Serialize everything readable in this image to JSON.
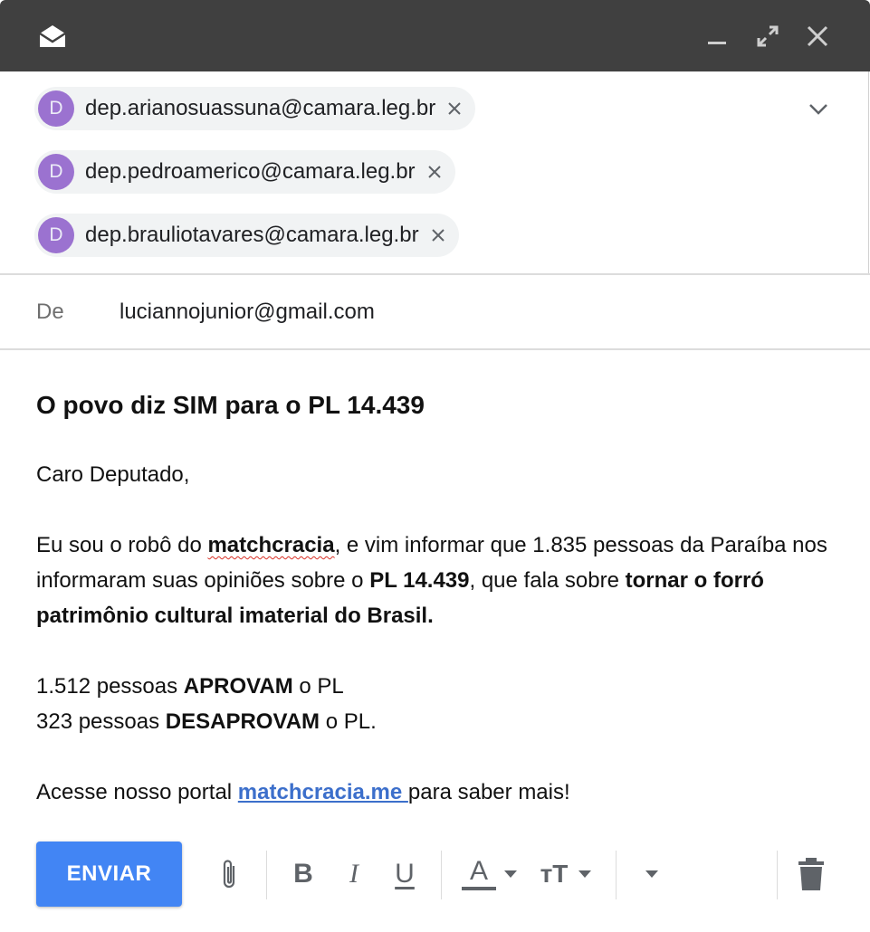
{
  "window": {
    "icons": [
      "envelope-open-icon",
      "minimize-icon",
      "expand-icon",
      "close-icon"
    ]
  },
  "recipients": [
    {
      "initial": "D",
      "email": "dep.arianosuassuna@camara.leg.br"
    },
    {
      "initial": "D",
      "email": "dep.pedroamerico@camara.leg.br"
    },
    {
      "initial": "D",
      "email": "dep.brauliotavares@camara.leg.br"
    }
  ],
  "from": {
    "label": "De",
    "value": "luciannojunior@gmail.com"
  },
  "message": {
    "subject": "O povo diz SIM para o PL 14.439",
    "greeting": "Caro Deputado,",
    "p1_a": "Eu sou o robô do ",
    "p1_brand": "matchcracia",
    "p1_b": ", e vim informar que 1.835 pessoas da Paraíba nos informaram suas opiniões sobre o ",
    "p1_pl": "PL 14.439",
    "p1_c": ", que fala sobre ",
    "p1_topic": "tornar o forró patrimônio cultural imaterial do Brasil.",
    "approve_count": "1.512 pessoas ",
    "approve_word": "APROVAM",
    "approve_tail": " o PL",
    "disapprove_count": "323 pessoas ",
    "disapprove_word": "DESAPROVAM",
    "disapprove_tail": " o PL.",
    "cta_a": "Acesse nosso portal ",
    "cta_link": "matchcracia.me ",
    "cta_b": "para saber mais!"
  },
  "toolbar": {
    "send_label": "ENVIAR",
    "bold_label": "B",
    "italic_label": "I",
    "underline_label": "U",
    "text_color_label": "A",
    "text_size_label": "тT"
  },
  "colors": {
    "accent": "#4285f4",
    "titlebar": "#404040",
    "avatar": "#9b72d0",
    "link": "#3c6fcb"
  }
}
